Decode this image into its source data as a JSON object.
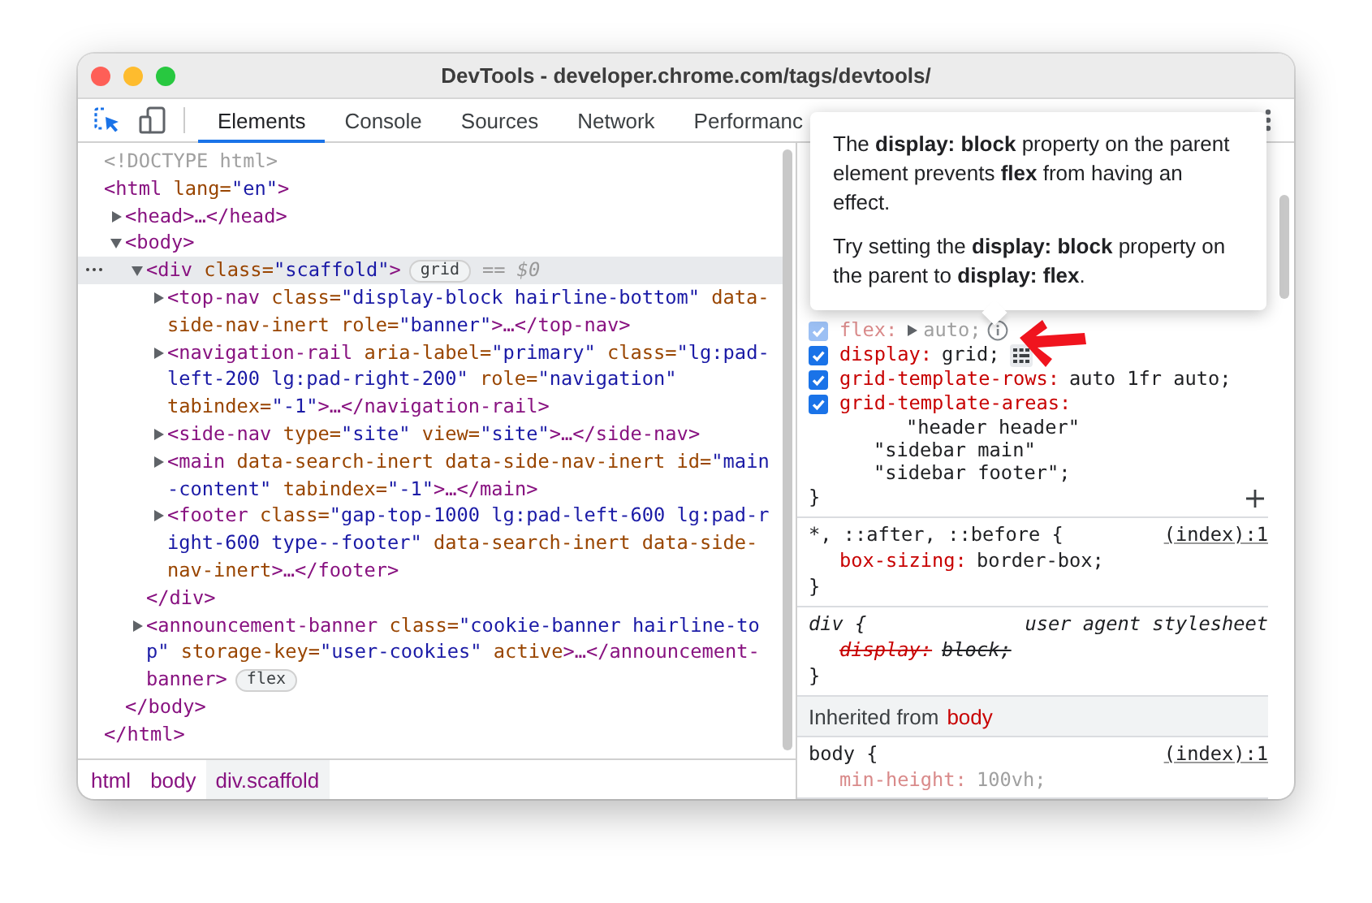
{
  "window": {
    "title": "DevTools - developer.chrome.com/tags/devtools/"
  },
  "tabs": [
    {
      "label": "Elements",
      "selected": true
    },
    {
      "label": "Console",
      "selected": false
    },
    {
      "label": "Sources",
      "selected": false
    },
    {
      "label": "Network",
      "selected": false
    },
    {
      "label": "Performanc",
      "selected": false
    }
  ],
  "dom_tree": [
    {
      "lines": [
        [
          {
            "kind": "comment",
            "text": "<!DOCTYPE html>"
          }
        ]
      ]
    },
    {
      "lines": [
        [
          {
            "kind": "tag",
            "text": "<html"
          },
          {
            "kind": "attr",
            "text": " lang="
          },
          {
            "kind": "value",
            "text": "\"en\""
          },
          {
            "kind": "tag",
            "text": ">"
          }
        ]
      ],
      "close": [
        {
          "kind": "tag",
          "text": "</html>"
        }
      ],
      "children": [
        {
          "expanded": false,
          "lines": [
            [
              {
                "kind": "tag",
                "text": "<head>…</head>"
              }
            ]
          ]
        },
        {
          "expanded": true,
          "lines": [
            [
              {
                "kind": "tag",
                "text": "<body>"
              }
            ]
          ],
          "close": [
            {
              "kind": "tag",
              "text": "</body>"
            }
          ],
          "children": [
            {
              "expanded": true,
              "selected": true,
              "badge": "grid",
              "marker": "== $0",
              "lines": [
                [
                  {
                    "kind": "tag",
                    "text": "<div"
                  },
                  {
                    "kind": "attr",
                    "text": " class="
                  },
                  {
                    "kind": "value",
                    "text": "\"scaffold\""
                  },
                  {
                    "kind": "tag",
                    "text": ">"
                  }
                ]
              ],
              "close": [
                {
                  "kind": "tag",
                  "text": "</div>"
                }
              ],
              "children": [
                {
                  "expanded": false,
                  "lines": [
                    [
                      {
                        "kind": "tag",
                        "text": "<top-nav"
                      },
                      {
                        "kind": "attr",
                        "text": " class="
                      },
                      {
                        "kind": "value",
                        "text": "\"display-block hairline-bottom\""
                      },
                      {
                        "kind": "attr",
                        "text": " data-"
                      }
                    ],
                    [
                      {
                        "kind": "attr",
                        "text": "side-nav-inert"
                      },
                      {
                        "kind": "attr",
                        "text": " role="
                      },
                      {
                        "kind": "value",
                        "text": "\"banner\""
                      },
                      {
                        "kind": "tag",
                        "text": ">…</top-nav>"
                      }
                    ]
                  ]
                },
                {
                  "expanded": false,
                  "lines": [
                    [
                      {
                        "kind": "tag",
                        "text": "<navigation-rail"
                      },
                      {
                        "kind": "attr",
                        "text": " aria-label="
                      },
                      {
                        "kind": "value",
                        "text": "\"primary\""
                      },
                      {
                        "kind": "attr",
                        "text": " class="
                      },
                      {
                        "kind": "value",
                        "text": "\"lg:pad-"
                      }
                    ],
                    [
                      {
                        "kind": "value",
                        "text": "left-200 lg:pad-right-200\""
                      },
                      {
                        "kind": "attr",
                        "text": " role="
                      },
                      {
                        "kind": "value",
                        "text": "\"navigation\""
                      }
                    ],
                    [
                      {
                        "kind": "attr",
                        "text": "tabindex="
                      },
                      {
                        "kind": "value",
                        "text": "\"-1\""
                      },
                      {
                        "kind": "tag",
                        "text": ">…</navigation-rail>"
                      }
                    ]
                  ]
                },
                {
                  "expanded": false,
                  "lines": [
                    [
                      {
                        "kind": "tag",
                        "text": "<side-nav"
                      },
                      {
                        "kind": "attr",
                        "text": " type="
                      },
                      {
                        "kind": "value",
                        "text": "\"site\""
                      },
                      {
                        "kind": "attr",
                        "text": " view="
                      },
                      {
                        "kind": "value",
                        "text": "\"site\""
                      },
                      {
                        "kind": "tag",
                        "text": ">…</side-nav>"
                      }
                    ]
                  ]
                },
                {
                  "expanded": false,
                  "lines": [
                    [
                      {
                        "kind": "tag",
                        "text": "<main"
                      },
                      {
                        "kind": "attr",
                        "text": " data-search-inert"
                      },
                      {
                        "kind": "attr",
                        "text": " data-side-nav-inert"
                      },
                      {
                        "kind": "attr",
                        "text": " id="
                      },
                      {
                        "kind": "value",
                        "text": "\"main"
                      }
                    ],
                    [
                      {
                        "kind": "value",
                        "text": "-content\""
                      },
                      {
                        "kind": "attr",
                        "text": " tabindex="
                      },
                      {
                        "kind": "value",
                        "text": "\"-1\""
                      },
                      {
                        "kind": "tag",
                        "text": ">…</main>"
                      }
                    ]
                  ]
                },
                {
                  "expanded": false,
                  "lines": [
                    [
                      {
                        "kind": "tag",
                        "text": "<footer"
                      },
                      {
                        "kind": "attr",
                        "text": " class="
                      },
                      {
                        "kind": "value",
                        "text": "\"gap-top-1000 lg:pad-left-600 lg:pad-r"
                      }
                    ],
                    [
                      {
                        "kind": "value",
                        "text": "ight-600 type--footer\""
                      },
                      {
                        "kind": "attr",
                        "text": " data-search-inert"
                      },
                      {
                        "kind": "attr",
                        "text": " data-side-"
                      }
                    ],
                    [
                      {
                        "kind": "attr",
                        "text": "nav-inert"
                      },
                      {
                        "kind": "tag",
                        "text": ">…</footer>"
                      }
                    ]
                  ]
                }
              ]
            },
            {
              "expanded": false,
              "badge": "flex",
              "lines": [
                [
                  {
                    "kind": "tag",
                    "text": "<announcement-banner"
                  },
                  {
                    "kind": "attr",
                    "text": " class="
                  },
                  {
                    "kind": "value",
                    "text": "\"cookie-banner hairline-to"
                  }
                ],
                [
                  {
                    "kind": "value",
                    "text": "p\""
                  },
                  {
                    "kind": "attr",
                    "text": " storage-key="
                  },
                  {
                    "kind": "value",
                    "text": "\"user-cookies\""
                  },
                  {
                    "kind": "attr",
                    "text": " active"
                  },
                  {
                    "kind": "tag",
                    "text": ">…</announcement-"
                  }
                ],
                [
                  {
                    "kind": "tag",
                    "text": "banner>"
                  }
                ]
              ]
            }
          ]
        }
      ]
    }
  ],
  "breadcrumbs": [
    {
      "label": "html",
      "selected": false
    },
    {
      "label": "body",
      "selected": false
    },
    {
      "label": "div.scaffold",
      "selected": true
    }
  ],
  "styles": [
    {
      "kind": "rule",
      "close": "}",
      "add_button": true,
      "declarations": [
        {
          "name": "flex:",
          "value": "auto;",
          "checked": true,
          "inactive": true,
          "expanded": false,
          "hint": true
        },
        {
          "name": "display:",
          "value": "grid;",
          "checked": true,
          "inactive": false,
          "grid_editor": true
        },
        {
          "name": "grid-template-rows:",
          "value": "auto 1fr auto;",
          "checked": true,
          "inactive": false
        },
        {
          "name": "grid-template-areas:",
          "checked": true,
          "inactive": false,
          "value_lines": [
            "\"header header\"",
            "\"sidebar main\"",
            "\"sidebar footer\";"
          ]
        }
      ]
    },
    {
      "kind": "rule",
      "user_agent": false,
      "selector": "*, ::after, ::before {",
      "source": "(index):1",
      "close": "}",
      "declarations": [
        {
          "name": "box-sizing:",
          "value": "border-box;"
        }
      ]
    },
    {
      "kind": "rule",
      "user_agent": true,
      "selector": "div {",
      "source": "user agent stylesheet",
      "close": "}",
      "declarations": [
        {
          "name": "display:",
          "value": "block;",
          "overridden": true
        }
      ]
    },
    {
      "kind": "inherited",
      "label": "Inherited from",
      "element": "body"
    },
    {
      "kind": "rule",
      "user_agent": false,
      "selector": "body {",
      "source": "(index):1",
      "declarations": [
        {
          "name": "min-height:",
          "value": "100vh;",
          "dimmed": true
        }
      ]
    }
  ],
  "tooltip": {
    "paragraphs": [
      "The **display: block** property on the parent element prevents **flex** from having an effect.",
      "Try setting the **display: block** property on the parent to **display: flex**."
    ]
  }
}
